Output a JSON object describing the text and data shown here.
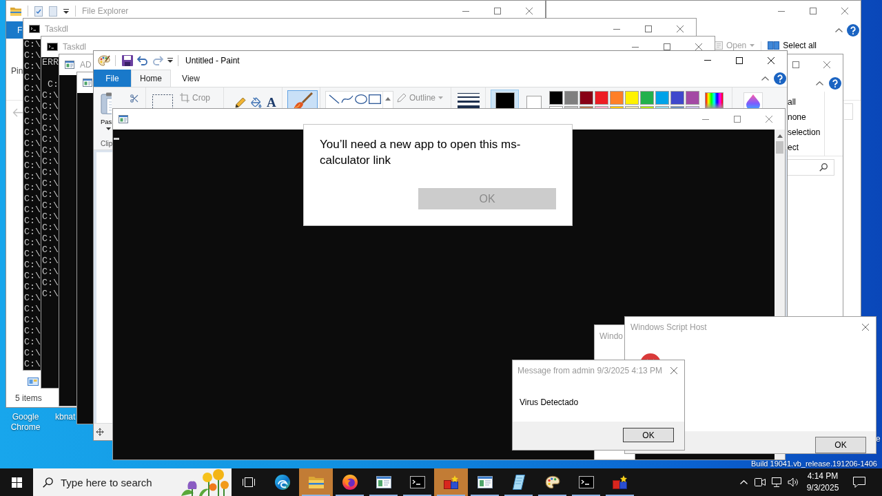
{
  "desktop": {
    "icon_labels": [
      "Google Chrome",
      "kbnat"
    ],
    "corner_text": "e",
    "build_info": "Build 19041.vb_release.191206-1406"
  },
  "explorer_back": {
    "ribbon": [
      {
        "kind": "open",
        "label": "Open",
        "disabled": true
      },
      {
        "kind": "select_all",
        "label": "Select all",
        "disabled": false
      }
    ]
  },
  "explorer_side": {
    "ribbon_items": [
      "all",
      "none",
      "selection",
      "ect"
    ]
  },
  "explorer_front": {
    "title": "File Explorer",
    "file_tab": "F",
    "ribbon_label": "Pin",
    "status": "5 items"
  },
  "consoles": [
    {
      "kind": "cmd",
      "title": "Taskdl",
      "cursor": false,
      "blocks": [
        [
          "C:\\",
          "C:\\",
          "C:\\",
          "C:\\",
          "C:\\",
          "C:\\",
          "C:\\",
          "C:\\",
          "C:\\",
          "C:\\",
          "C:\\",
          "C:\\",
          "C:\\",
          "C:\\",
          "C:\\",
          "C:\\",
          "C:\\",
          "C:\\",
          "C:\\",
          "C:\\",
          "C:\\",
          "C:\\",
          "C:\\",
          "C:\\",
          "C:\\",
          "C:\\",
          "C:\\",
          "C:\\",
          "C:\\",
          "C:\\"
        ]
      ]
    },
    {
      "kind": "cmd",
      "title": "Taskdl",
      "cursor": false,
      "blocks": [
        [
          "ERR"
        ],
        [
          " C:",
          "C:\\",
          "C:\\",
          "C:\\",
          "C:\\",
          "C:\\",
          "C:\\",
          "C:\\",
          "C:\\",
          "C:\\",
          "C:\\",
          "C:\\",
          "C:\\",
          "C:\\",
          "C:\\",
          "C:\\",
          "C:\\",
          "C:\\",
          "C:\\",
          "C:\\"
        ]
      ]
    },
    {
      "kind": "app",
      "title": "AD",
      "cursor": false
    },
    {
      "kind": "app",
      "cursor": false
    },
    {
      "kind": "app",
      "cursor": true
    }
  ],
  "paint": {
    "title": "Untitled - Paint",
    "tabs": [
      {
        "kind": "file",
        "label": "File",
        "selected": false
      },
      {
        "kind": "tab",
        "label": "Home",
        "selected": true
      },
      {
        "kind": "tab",
        "label": "View",
        "selected": false
      }
    ],
    "paste_label": "Pas",
    "clipboard_label": "Clip",
    "crop": {
      "label": "Crop",
      "disabled": true
    },
    "tools": [
      {
        "kind": "pencil",
        "selected": false
      },
      {
        "kind": "fill",
        "selected": false
      },
      {
        "kind": "text",
        "glyph": "A",
        "selected": false
      }
    ],
    "brushes": {
      "selected": true
    },
    "outline": {
      "label": "Outline",
      "disabled": true
    },
    "active_colors": [
      {
        "color": "#000000",
        "selected": true
      },
      {
        "color": "#ffffff",
        "selected": false
      }
    ],
    "palette": [
      {
        "color": "#000000"
      },
      {
        "color": "#7f7f7f"
      },
      {
        "color": "#880015"
      },
      {
        "color": "#ed1c24"
      },
      {
        "color": "#ff7f27"
      },
      {
        "color": "#fff200"
      },
      {
        "color": "#22b14c"
      },
      {
        "color": "#00a2e8"
      },
      {
        "color": "#3f48cc"
      },
      {
        "color": "#a349a4"
      },
      {
        "color": "#ffffff"
      },
      {
        "color": "#c3c3c3"
      },
      {
        "color": "#b97a57"
      },
      {
        "color": "#ffaec9"
      },
      {
        "color": "#ffc90e"
      },
      {
        "color": "#efe4b0"
      },
      {
        "color": "#b5e61d"
      },
      {
        "color": "#99d9ea"
      },
      {
        "color": "#7092be"
      },
      {
        "color": "#c8bfe7"
      }
    ]
  },
  "app_prompt": {
    "message": "You’ll need a new app to open this ms-calculator link",
    "button": {
      "label": "OK",
      "disabled": true
    }
  },
  "script_host_back": {
    "title": "Windo"
  },
  "script_host": {
    "title": "Windows Script Host",
    "button": "OK"
  },
  "admin_message": {
    "title": "Message from admin 9/3/2025 4:13 PM",
    "message": "Virus Detectado",
    "button": "OK"
  },
  "taskbar": {
    "search": {
      "placeholder": "Type here to search"
    },
    "apps": [
      {
        "kind": "edge",
        "running": false,
        "flashing": false
      },
      {
        "kind": "explorer",
        "running": true,
        "flashing": true
      },
      {
        "kind": "firefox",
        "running": true,
        "flashing": false
      },
      {
        "kind": "window",
        "running": true,
        "flashing": false
      },
      {
        "kind": "console",
        "running": true,
        "flashing": false
      },
      {
        "kind": "boxes",
        "running": true,
        "flashing": true
      },
      {
        "kind": "window",
        "running": true,
        "flashing": false
      },
      {
        "kind": "document",
        "running": true,
        "flashing": false
      },
      {
        "kind": "paint",
        "running": true,
        "flashing": false
      },
      {
        "kind": "console",
        "running": true,
        "flashing": false
      },
      {
        "kind": "boxes",
        "running": true,
        "flashing": false
      }
    ],
    "time": "4:14 PM",
    "date": "9/3/2025"
  }
}
